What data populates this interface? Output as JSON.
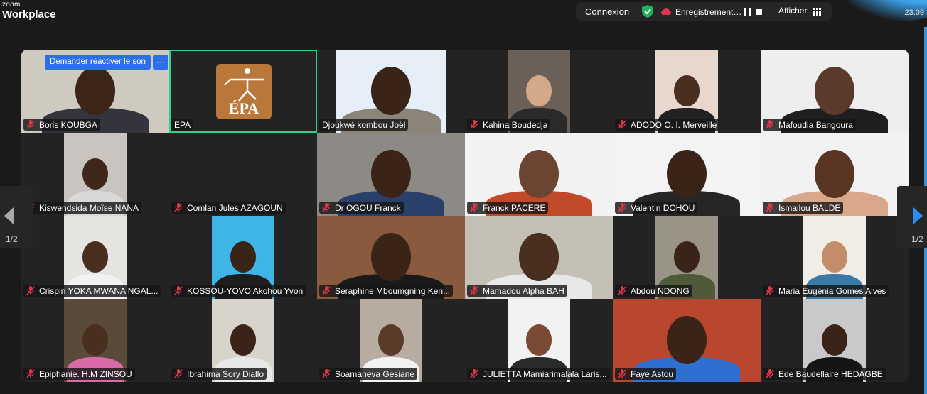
{
  "brand": {
    "small": "zoom",
    "big": "Workplace"
  },
  "topbar": {
    "connexion_label": "Connexion",
    "recording_label": "Enregistrement…",
    "view_label": "Afficher",
    "time": "23.09"
  },
  "colors": {
    "accent_blue": "#2d6fe6",
    "active_border": "#2dd18a",
    "muted_red": "#e0364c",
    "shield_green": "#1fb35a"
  },
  "unmute_request": {
    "label": "Demander réactiver le son",
    "more_label": "···"
  },
  "pagination": {
    "left": "1/2",
    "right": "1/2"
  },
  "participants": [
    {
      "name": "Boris KOUBGA",
      "muted": true,
      "bg": "#cfcac0",
      "skin": "#3b2518",
      "shirt": "#34343c",
      "view": "fill"
    },
    {
      "name": "EPA",
      "muted": false,
      "bg": "#232323",
      "view": "logo",
      "logo_text": "ÉPA",
      "active": true
    },
    {
      "name": "Djoukwé kombou Joël",
      "muted": false,
      "bg": "#e6eef7",
      "skin": "#3a2418",
      "shirt": "#8a8578",
      "view": "narrow"
    },
    {
      "name": "Kahina Boudedja",
      "muted": true,
      "bg": "#6a6058",
      "skin": "#d3a98a",
      "shirt": "#2a2a2a",
      "view": "small"
    },
    {
      "name": "ADODO O. I. Merveille",
      "muted": true,
      "bg": "#e8d7cc",
      "skin": "#4a2e20",
      "shirt": "#222",
      "view": "small"
    },
    {
      "name": "Mafoudia Bangoura",
      "muted": true,
      "bg": "#eeeeee",
      "skin": "#5a3a2a",
      "shirt": "#1f1f1f",
      "view": "fill"
    },
    {
      "name": "Kiswendsida Moïse NANA",
      "muted": true,
      "bg": "#c9c4bf",
      "skin": "#3e271b",
      "shirt": "#d8d8d8",
      "view": "small"
    },
    {
      "name": "Comlan Jules AZAGOUN",
      "muted": true,
      "bg": "#232323",
      "view": "none"
    },
    {
      "name": "Dr OGOU Franck",
      "muted": true,
      "bg": "#8d8a86",
      "skin": "#3a2418",
      "shirt": "#2a3f6a",
      "view": "fill"
    },
    {
      "name": "Franck PACERE",
      "muted": true,
      "bg": "#f2f2f2",
      "skin": "#6b4532",
      "shirt": "#c04a2a",
      "view": "fill"
    },
    {
      "name": "Valentin DOHOU",
      "muted": true,
      "bg": "#f3f3f3",
      "skin": "#3a2418",
      "shirt": "#262626",
      "view": "fill"
    },
    {
      "name": "Ismailou BALDE",
      "muted": true,
      "bg": "#f2f2f2",
      "skin": "#5a3524",
      "shirt": "#d9a88a",
      "view": "fill"
    },
    {
      "name": "Crispin YOKA MWANA NGAL...",
      "muted": true,
      "bg": "#e6e4e0",
      "skin": "#4a2e20",
      "shirt": "#f2f2f2",
      "view": "small"
    },
    {
      "name": "KOSSOU-YOVO Akohou Yvon",
      "muted": true,
      "bg": "#3fb5e6",
      "skin": "#3a2418",
      "shirt": "#1e1e1e",
      "view": "small"
    },
    {
      "name": "Seraphine Mboumgning Ken...",
      "muted": true,
      "bg": "#8a5a3e",
      "skin": "#3a2418",
      "shirt": "#1a1a1a",
      "view": "fill"
    },
    {
      "name": "Mamadou Alpha BAH",
      "muted": true,
      "bg": "#c5c0b6",
      "skin": "#4a2e20",
      "shirt": "#e8e8e8",
      "view": "fill"
    },
    {
      "name": "Abdou NDONG",
      "muted": true,
      "bg": "#9a9486",
      "skin": "#3a2418",
      "shirt": "#4e5a3a",
      "view": "small"
    },
    {
      "name": "Maria Eugénia Gomes Alves",
      "muted": true,
      "bg": "#f0ece6",
      "skin": "#c48d6a",
      "shirt": "#3a7aa6",
      "view": "small"
    },
    {
      "name": "Epiphanie. H.M ZINSOU",
      "muted": true,
      "bg": "#5a4a3a",
      "skin": "#4a2e20",
      "shirt": "#d86aa8",
      "view": "small"
    },
    {
      "name": "Ibrahima Sory Diallo",
      "muted": true,
      "bg": "#d8d4cc",
      "skin": "#3a2418",
      "shirt": "#e8e8e8",
      "view": "small"
    },
    {
      "name": "Soamaneva Gesiane",
      "muted": true,
      "bg": "#b8aca0",
      "skin": "#5a3a28",
      "shirt": "#f2f2f2",
      "view": "small"
    },
    {
      "name": "JULIETTA Mamiarimalala Laris...",
      "muted": true,
      "bg": "#f2f2f2",
      "skin": "#7a4a32",
      "shirt": "#2a2a2a",
      "view": "small"
    },
    {
      "name": "Faye Astou",
      "muted": true,
      "bg": "#b9462f",
      "skin": "#3a2418",
      "shirt": "#2f6fd0",
      "view": "fill"
    },
    {
      "name": "Ede Baudellaire HEDAGBE",
      "muted": true,
      "bg": "#c9c9c9",
      "skin": "#3a2418",
      "shirt": "#151515",
      "view": "small"
    }
  ]
}
